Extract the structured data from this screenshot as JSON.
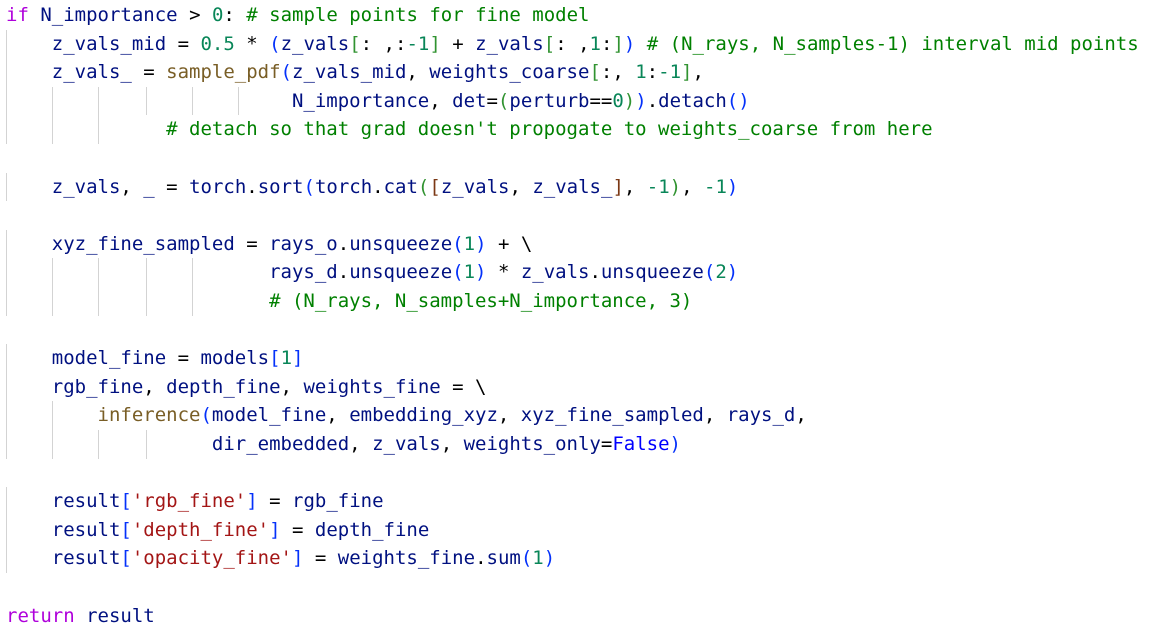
{
  "colors": {
    "background": "#ffffff",
    "keyword": "#af00db",
    "variable": "#001080",
    "function": "#795e26",
    "number": "#098658",
    "string": "#a31515",
    "comment": "#008000",
    "constant": "#0000ff",
    "operator": "#000000",
    "bracket_level1": "#0431fa",
    "bracket_level2": "#319331",
    "bracket_level3": "#7b3814",
    "indent_guide": "#d3d3d3"
  },
  "code": {
    "lines": [
      {
        "indent": 0,
        "guides": 0,
        "tokens": [
          {
            "t": "if",
            "k": "kw"
          },
          {
            "t": " ",
            "k": "op"
          },
          {
            "t": "N_importance",
            "k": "var"
          },
          {
            "t": " > ",
            "k": "op"
          },
          {
            "t": "0",
            "k": "num"
          },
          {
            "t": ": ",
            "k": "op"
          },
          {
            "t": "# sample points for fine model",
            "k": "cmt"
          }
        ]
      },
      {
        "indent": 4,
        "guides": 1,
        "tokens": [
          {
            "t": "z_vals_mid",
            "k": "var"
          },
          {
            "t": " = ",
            "k": "op"
          },
          {
            "t": "0.5",
            "k": "num"
          },
          {
            "t": " * ",
            "k": "op"
          },
          {
            "t": "(",
            "k": "br1"
          },
          {
            "t": "z_vals",
            "k": "var"
          },
          {
            "t": "[",
            "k": "br2"
          },
          {
            "t": ": ,:",
            "k": "op"
          },
          {
            "t": "-1",
            "k": "num"
          },
          {
            "t": "]",
            "k": "br2"
          },
          {
            "t": " + ",
            "k": "op"
          },
          {
            "t": "z_vals",
            "k": "var"
          },
          {
            "t": "[",
            "k": "br2"
          },
          {
            "t": ": ,",
            "k": "op"
          },
          {
            "t": "1",
            "k": "num"
          },
          {
            "t": ":",
            "k": "op"
          },
          {
            "t": "]",
            "k": "br2"
          },
          {
            "t": ")",
            "k": "br1"
          },
          {
            "t": " ",
            "k": "op"
          },
          {
            "t": "# (N_rays, N_samples-1) interval mid points",
            "k": "cmt"
          }
        ]
      },
      {
        "indent": 4,
        "guides": 1,
        "tokens": [
          {
            "t": "z_vals_",
            "k": "var"
          },
          {
            "t": " = ",
            "k": "op"
          },
          {
            "t": "sample_pdf",
            "k": "fn"
          },
          {
            "t": "(",
            "k": "br1"
          },
          {
            "t": "z_vals_mid",
            "k": "var"
          },
          {
            "t": ", ",
            "k": "op"
          },
          {
            "t": "weights_coarse",
            "k": "var"
          },
          {
            "t": "[",
            "k": "br2"
          },
          {
            "t": ":, ",
            "k": "op"
          },
          {
            "t": "1",
            "k": "num"
          },
          {
            "t": ":",
            "k": "op"
          },
          {
            "t": "-1",
            "k": "num"
          },
          {
            "t": "]",
            "k": "br2"
          },
          {
            "t": ",",
            "k": "op"
          }
        ]
      },
      {
        "indent": 25,
        "guides": 6,
        "tokens": [
          {
            "t": "N_importance",
            "k": "var"
          },
          {
            "t": ", ",
            "k": "op"
          },
          {
            "t": "det",
            "k": "var"
          },
          {
            "t": "=",
            "k": "op"
          },
          {
            "t": "(",
            "k": "br2"
          },
          {
            "t": "perturb",
            "k": "var"
          },
          {
            "t": "==",
            "k": "op"
          },
          {
            "t": "0",
            "k": "num"
          },
          {
            "t": ")",
            "k": "br2"
          },
          {
            "t": ")",
            "k": "br1"
          },
          {
            "t": ".",
            "k": "op"
          },
          {
            "t": "detach",
            "k": "var"
          },
          {
            "t": "()",
            "k": "br1"
          }
        ]
      },
      {
        "indent": 14,
        "guides": 3,
        "tokens": [
          {
            "t": "# detach so that grad doesn't propogate to weights_coarse from here",
            "k": "cmt"
          }
        ]
      },
      {
        "indent": 0,
        "guides": 0,
        "tokens": []
      },
      {
        "indent": 4,
        "guides": 1,
        "tokens": [
          {
            "t": "z_vals",
            "k": "var"
          },
          {
            "t": ", ",
            "k": "op"
          },
          {
            "t": "_",
            "k": "var"
          },
          {
            "t": " = ",
            "k": "op"
          },
          {
            "t": "torch",
            "k": "var"
          },
          {
            "t": ".",
            "k": "op"
          },
          {
            "t": "sort",
            "k": "var"
          },
          {
            "t": "(",
            "k": "br1"
          },
          {
            "t": "torch",
            "k": "var"
          },
          {
            "t": ".",
            "k": "op"
          },
          {
            "t": "cat",
            "k": "var"
          },
          {
            "t": "(",
            "k": "br2"
          },
          {
            "t": "[",
            "k": "br3"
          },
          {
            "t": "z_vals",
            "k": "var"
          },
          {
            "t": ", ",
            "k": "op"
          },
          {
            "t": "z_vals_",
            "k": "var"
          },
          {
            "t": "]",
            "k": "br3"
          },
          {
            "t": ", ",
            "k": "op"
          },
          {
            "t": "-1",
            "k": "num"
          },
          {
            "t": ")",
            "k": "br2"
          },
          {
            "t": ", ",
            "k": "op"
          },
          {
            "t": "-1",
            "k": "num"
          },
          {
            "t": ")",
            "k": "br1"
          }
        ]
      },
      {
        "indent": 0,
        "guides": 0,
        "tokens": []
      },
      {
        "indent": 4,
        "guides": 1,
        "tokens": [
          {
            "t": "xyz_fine_sampled",
            "k": "var"
          },
          {
            "t": " = ",
            "k": "op"
          },
          {
            "t": "rays_o",
            "k": "var"
          },
          {
            "t": ".",
            "k": "op"
          },
          {
            "t": "unsqueeze",
            "k": "var"
          },
          {
            "t": "(",
            "k": "br1"
          },
          {
            "t": "1",
            "k": "num"
          },
          {
            "t": ")",
            "k": "br1"
          },
          {
            "t": " + \\",
            "k": "op"
          }
        ]
      },
      {
        "indent": 23,
        "guides": 5,
        "tokens": [
          {
            "t": "rays_d",
            "k": "var"
          },
          {
            "t": ".",
            "k": "op"
          },
          {
            "t": "unsqueeze",
            "k": "var"
          },
          {
            "t": "(",
            "k": "br1"
          },
          {
            "t": "1",
            "k": "num"
          },
          {
            "t": ")",
            "k": "br1"
          },
          {
            "t": " * ",
            "k": "op"
          },
          {
            "t": "z_vals",
            "k": "var"
          },
          {
            "t": ".",
            "k": "op"
          },
          {
            "t": "unsqueeze",
            "k": "var"
          },
          {
            "t": "(",
            "k": "br1"
          },
          {
            "t": "2",
            "k": "num"
          },
          {
            "t": ")",
            "k": "br1"
          }
        ]
      },
      {
        "indent": 23,
        "guides": 5,
        "tokens": [
          {
            "t": "# (N_rays, N_samples+N_importance, 3)",
            "k": "cmt"
          }
        ]
      },
      {
        "indent": 0,
        "guides": 0,
        "tokens": []
      },
      {
        "indent": 4,
        "guides": 1,
        "tokens": [
          {
            "t": "model_fine",
            "k": "var"
          },
          {
            "t": " = ",
            "k": "op"
          },
          {
            "t": "models",
            "k": "var"
          },
          {
            "t": "[",
            "k": "br1"
          },
          {
            "t": "1",
            "k": "num"
          },
          {
            "t": "]",
            "k": "br1"
          }
        ]
      },
      {
        "indent": 4,
        "guides": 1,
        "tokens": [
          {
            "t": "rgb_fine",
            "k": "var"
          },
          {
            "t": ", ",
            "k": "op"
          },
          {
            "t": "depth_fine",
            "k": "var"
          },
          {
            "t": ", ",
            "k": "op"
          },
          {
            "t": "weights_fine",
            "k": "var"
          },
          {
            "t": " = \\",
            "k": "op"
          }
        ]
      },
      {
        "indent": 8,
        "guides": 2,
        "tokens": [
          {
            "t": "inference",
            "k": "fn"
          },
          {
            "t": "(",
            "k": "br1"
          },
          {
            "t": "model_fine",
            "k": "var"
          },
          {
            "t": ", ",
            "k": "op"
          },
          {
            "t": "embedding_xyz",
            "k": "var"
          },
          {
            "t": ", ",
            "k": "op"
          },
          {
            "t": "xyz_fine_sampled",
            "k": "var"
          },
          {
            "t": ", ",
            "k": "op"
          },
          {
            "t": "rays_d",
            "k": "var"
          },
          {
            "t": ",",
            "k": "op"
          }
        ]
      },
      {
        "indent": 18,
        "guides": 4,
        "tokens": [
          {
            "t": "dir_embedded",
            "k": "var"
          },
          {
            "t": ", ",
            "k": "op"
          },
          {
            "t": "z_vals",
            "k": "var"
          },
          {
            "t": ", ",
            "k": "op"
          },
          {
            "t": "weights_only",
            "k": "var"
          },
          {
            "t": "=",
            "k": "op"
          },
          {
            "t": "False",
            "k": "const"
          },
          {
            "t": ")",
            "k": "br1"
          }
        ]
      },
      {
        "indent": 0,
        "guides": 0,
        "tokens": []
      },
      {
        "indent": 4,
        "guides": 1,
        "tokens": [
          {
            "t": "result",
            "k": "var"
          },
          {
            "t": "[",
            "k": "br1"
          },
          {
            "t": "'rgb_fine'",
            "k": "str"
          },
          {
            "t": "]",
            "k": "br1"
          },
          {
            "t": " = ",
            "k": "op"
          },
          {
            "t": "rgb_fine",
            "k": "var"
          }
        ]
      },
      {
        "indent": 4,
        "guides": 1,
        "tokens": [
          {
            "t": "result",
            "k": "var"
          },
          {
            "t": "[",
            "k": "br1"
          },
          {
            "t": "'depth_fine'",
            "k": "str"
          },
          {
            "t": "]",
            "k": "br1"
          },
          {
            "t": " = ",
            "k": "op"
          },
          {
            "t": "depth_fine",
            "k": "var"
          }
        ]
      },
      {
        "indent": 4,
        "guides": 1,
        "tokens": [
          {
            "t": "result",
            "k": "var"
          },
          {
            "t": "[",
            "k": "br1"
          },
          {
            "t": "'opacity_fine'",
            "k": "str"
          },
          {
            "t": "]",
            "k": "br1"
          },
          {
            "t": " = ",
            "k": "op"
          },
          {
            "t": "weights_fine",
            "k": "var"
          },
          {
            "t": ".",
            "k": "op"
          },
          {
            "t": "sum",
            "k": "var"
          },
          {
            "t": "(",
            "k": "br1"
          },
          {
            "t": "1",
            "k": "num"
          },
          {
            "t": ")",
            "k": "br1"
          }
        ]
      },
      {
        "indent": 0,
        "guides": 0,
        "tokens": []
      },
      {
        "indent": 0,
        "guides": 0,
        "tokens": [
          {
            "t": "return",
            "k": "kw"
          },
          {
            "t": " ",
            "k": "op"
          },
          {
            "t": "result",
            "k": "var"
          }
        ]
      }
    ]
  }
}
